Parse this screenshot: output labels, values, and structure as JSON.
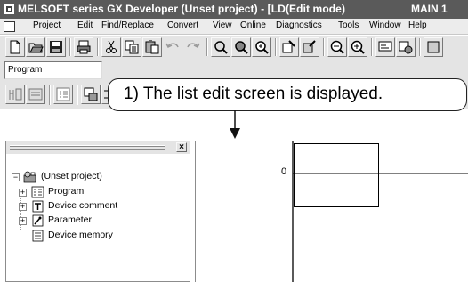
{
  "window": {
    "title": "MELSOFT series GX Developer (Unset project) - [LD(Edit mode)",
    "title_right": "MAIN   1"
  },
  "menu": {
    "items": [
      "Project",
      "Edit",
      "Find/Replace",
      "Convert",
      "View",
      "Online",
      "Diagnostics",
      "Tools",
      "Window",
      "Help"
    ]
  },
  "toolbar": {
    "program_combo_value": "Program"
  },
  "callout": {
    "text": "1) The list edit screen is displayed."
  },
  "project_tree": {
    "root": "(Unset project)",
    "items": [
      "Program",
      "Device comment",
      "Parameter",
      "Device memory"
    ]
  },
  "ladder": {
    "step_number": "0"
  }
}
